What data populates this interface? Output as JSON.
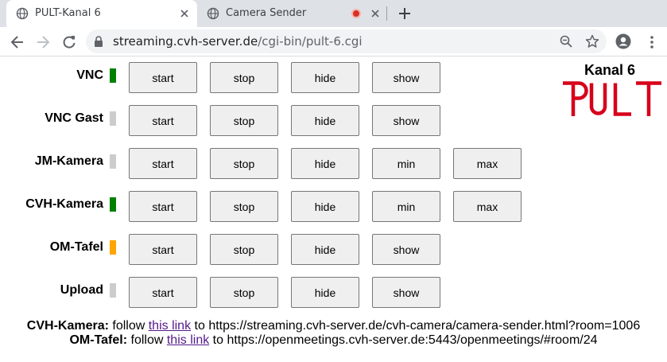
{
  "browser": {
    "tabs": [
      {
        "title": "PULT-Kanal 6",
        "active": true
      },
      {
        "title": "Camera Sender",
        "active": false,
        "recording": true
      }
    ],
    "url_host": "streaming.cvh-server.de",
    "url_path": "/cgi-bin/pult-6.cgi"
  },
  "logo": {
    "title": "Kanal 6",
    "text": "PULT",
    "color": "#d7001b"
  },
  "colors": {
    "green": "#008000",
    "gray": "#cccccc",
    "orange": "#ffa500"
  },
  "rows": [
    {
      "label": "VNC",
      "status": "green",
      "buttons": [
        "start",
        "stop",
        "hide",
        "show"
      ]
    },
    {
      "label": "VNC Gast",
      "status": "gray",
      "buttons": [
        "start",
        "stop",
        "hide",
        "show"
      ]
    },
    {
      "label": "JM-Kamera",
      "status": "gray",
      "buttons": [
        "start",
        "stop",
        "hide",
        "min",
        "max"
      ]
    },
    {
      "label": "CVH-Kamera",
      "status": "green",
      "buttons": [
        "start",
        "stop",
        "hide",
        "min",
        "max"
      ]
    },
    {
      "label": "OM-Tafel",
      "status": "orange",
      "buttons": [
        "start",
        "stop",
        "hide",
        "show"
      ]
    },
    {
      "label": "Upload",
      "status": "gray",
      "buttons": [
        "start",
        "stop",
        "hide",
        "show"
      ]
    }
  ],
  "footer": [
    {
      "name": "CVH-Kamera:",
      "before": " follow ",
      "link": "this link",
      "after": " to https://streaming.cvh-server.de/cvh-camera/camera-sender.html?room=1006"
    },
    {
      "name": "OM-Tafel:",
      "before": " follow ",
      "link": "this link",
      "after": " to https://openmeetings.cvh-server.de:5443/openmeetings/#room/24"
    }
  ]
}
